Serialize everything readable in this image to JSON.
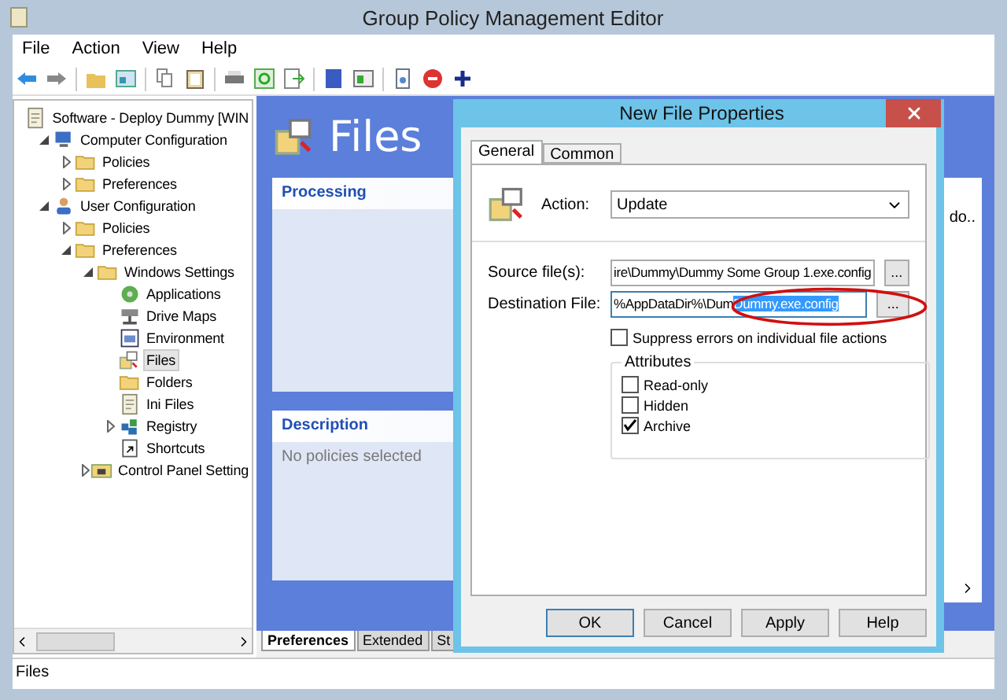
{
  "window": {
    "title": "Group Policy Management Editor"
  },
  "menu": [
    "File",
    "Action",
    "View",
    "Help"
  ],
  "tree": [
    {
      "label": "Software - Deploy Dummy [WIN",
      "kind": "gpo",
      "selected": false,
      "children": [
        {
          "label": "Computer Configuration",
          "kind": "computer",
          "expanded": true,
          "selected": false,
          "children": [
            {
              "label": "Policies",
              "kind": "folder",
              "expanded": false,
              "selected": false
            },
            {
              "label": "Preferences",
              "kind": "folder",
              "expanded": false,
              "selected": false
            }
          ]
        },
        {
          "label": "User Configuration",
          "kind": "user",
          "expanded": true,
          "selected": false,
          "children": [
            {
              "label": "Policies",
              "kind": "folder",
              "expanded": false,
              "selected": false
            },
            {
              "label": "Preferences",
              "kind": "folder",
              "expanded": true,
              "selected": false,
              "children": [
                {
                  "label": "Windows Settings",
                  "kind": "folder",
                  "expanded": true,
                  "selected": false,
                  "children": [
                    {
                      "label": "Applications",
                      "kind": "applications",
                      "selected": false
                    },
                    {
                      "label": "Drive Maps",
                      "kind": "drive",
                      "selected": false
                    },
                    {
                      "label": "Environment",
                      "kind": "environment",
                      "selected": false
                    },
                    {
                      "label": "Files",
                      "kind": "files",
                      "selected": true
                    },
                    {
                      "label": "Folders",
                      "kind": "folders",
                      "selected": false
                    },
                    {
                      "label": "Ini Files",
                      "kind": "ini",
                      "selected": false
                    },
                    {
                      "label": "Registry",
                      "kind": "registry",
                      "expanded": false,
                      "selected": false
                    },
                    {
                      "label": "Shortcuts",
                      "kind": "shortcut",
                      "selected": false
                    }
                  ]
                },
                {
                  "label": "Control Panel Setting",
                  "kind": "control-panel",
                  "expanded": false,
                  "selected": false
                }
              ]
            }
          ]
        }
      ]
    }
  ],
  "right_pane": {
    "title": "Files",
    "panels": [
      {
        "heading": "Processing"
      },
      {
        "heading": "Description",
        "text": "No policies selected"
      }
    ],
    "list_text": "do..",
    "tabs": [
      {
        "label": "Preferences",
        "selected": true
      },
      {
        "label": "Extended",
        "selected": false
      },
      {
        "label": "St",
        "selected": false
      }
    ]
  },
  "dialog": {
    "title": "New File Properties",
    "tabs": [
      {
        "label": "General",
        "selected": true
      },
      {
        "label": "Common",
        "selected": false
      }
    ],
    "action": {
      "label": "Action:",
      "value": "Update"
    },
    "source": {
      "label": "Source file(s):",
      "value": "ire\\Dummy\\Dummy Some Group 1.exe.config",
      "browse": "..."
    },
    "destination": {
      "label": "Destination File:",
      "value": "%AppDataDir%\\Dum",
      "selected_text": "Dummy.exe.config",
      "browse": "..."
    },
    "suppress": {
      "label": "Suppress errors on individual file actions",
      "checked": false
    },
    "attributes": {
      "title": "Attributes",
      "items": [
        {
          "label": "Read-only",
          "checked": false
        },
        {
          "label": "Hidden",
          "checked": false
        },
        {
          "label": "Archive",
          "checked": true
        }
      ]
    },
    "buttons": [
      "OK",
      "Cancel",
      "Apply",
      "Help"
    ]
  },
  "status_bar": {
    "text": "Files"
  }
}
